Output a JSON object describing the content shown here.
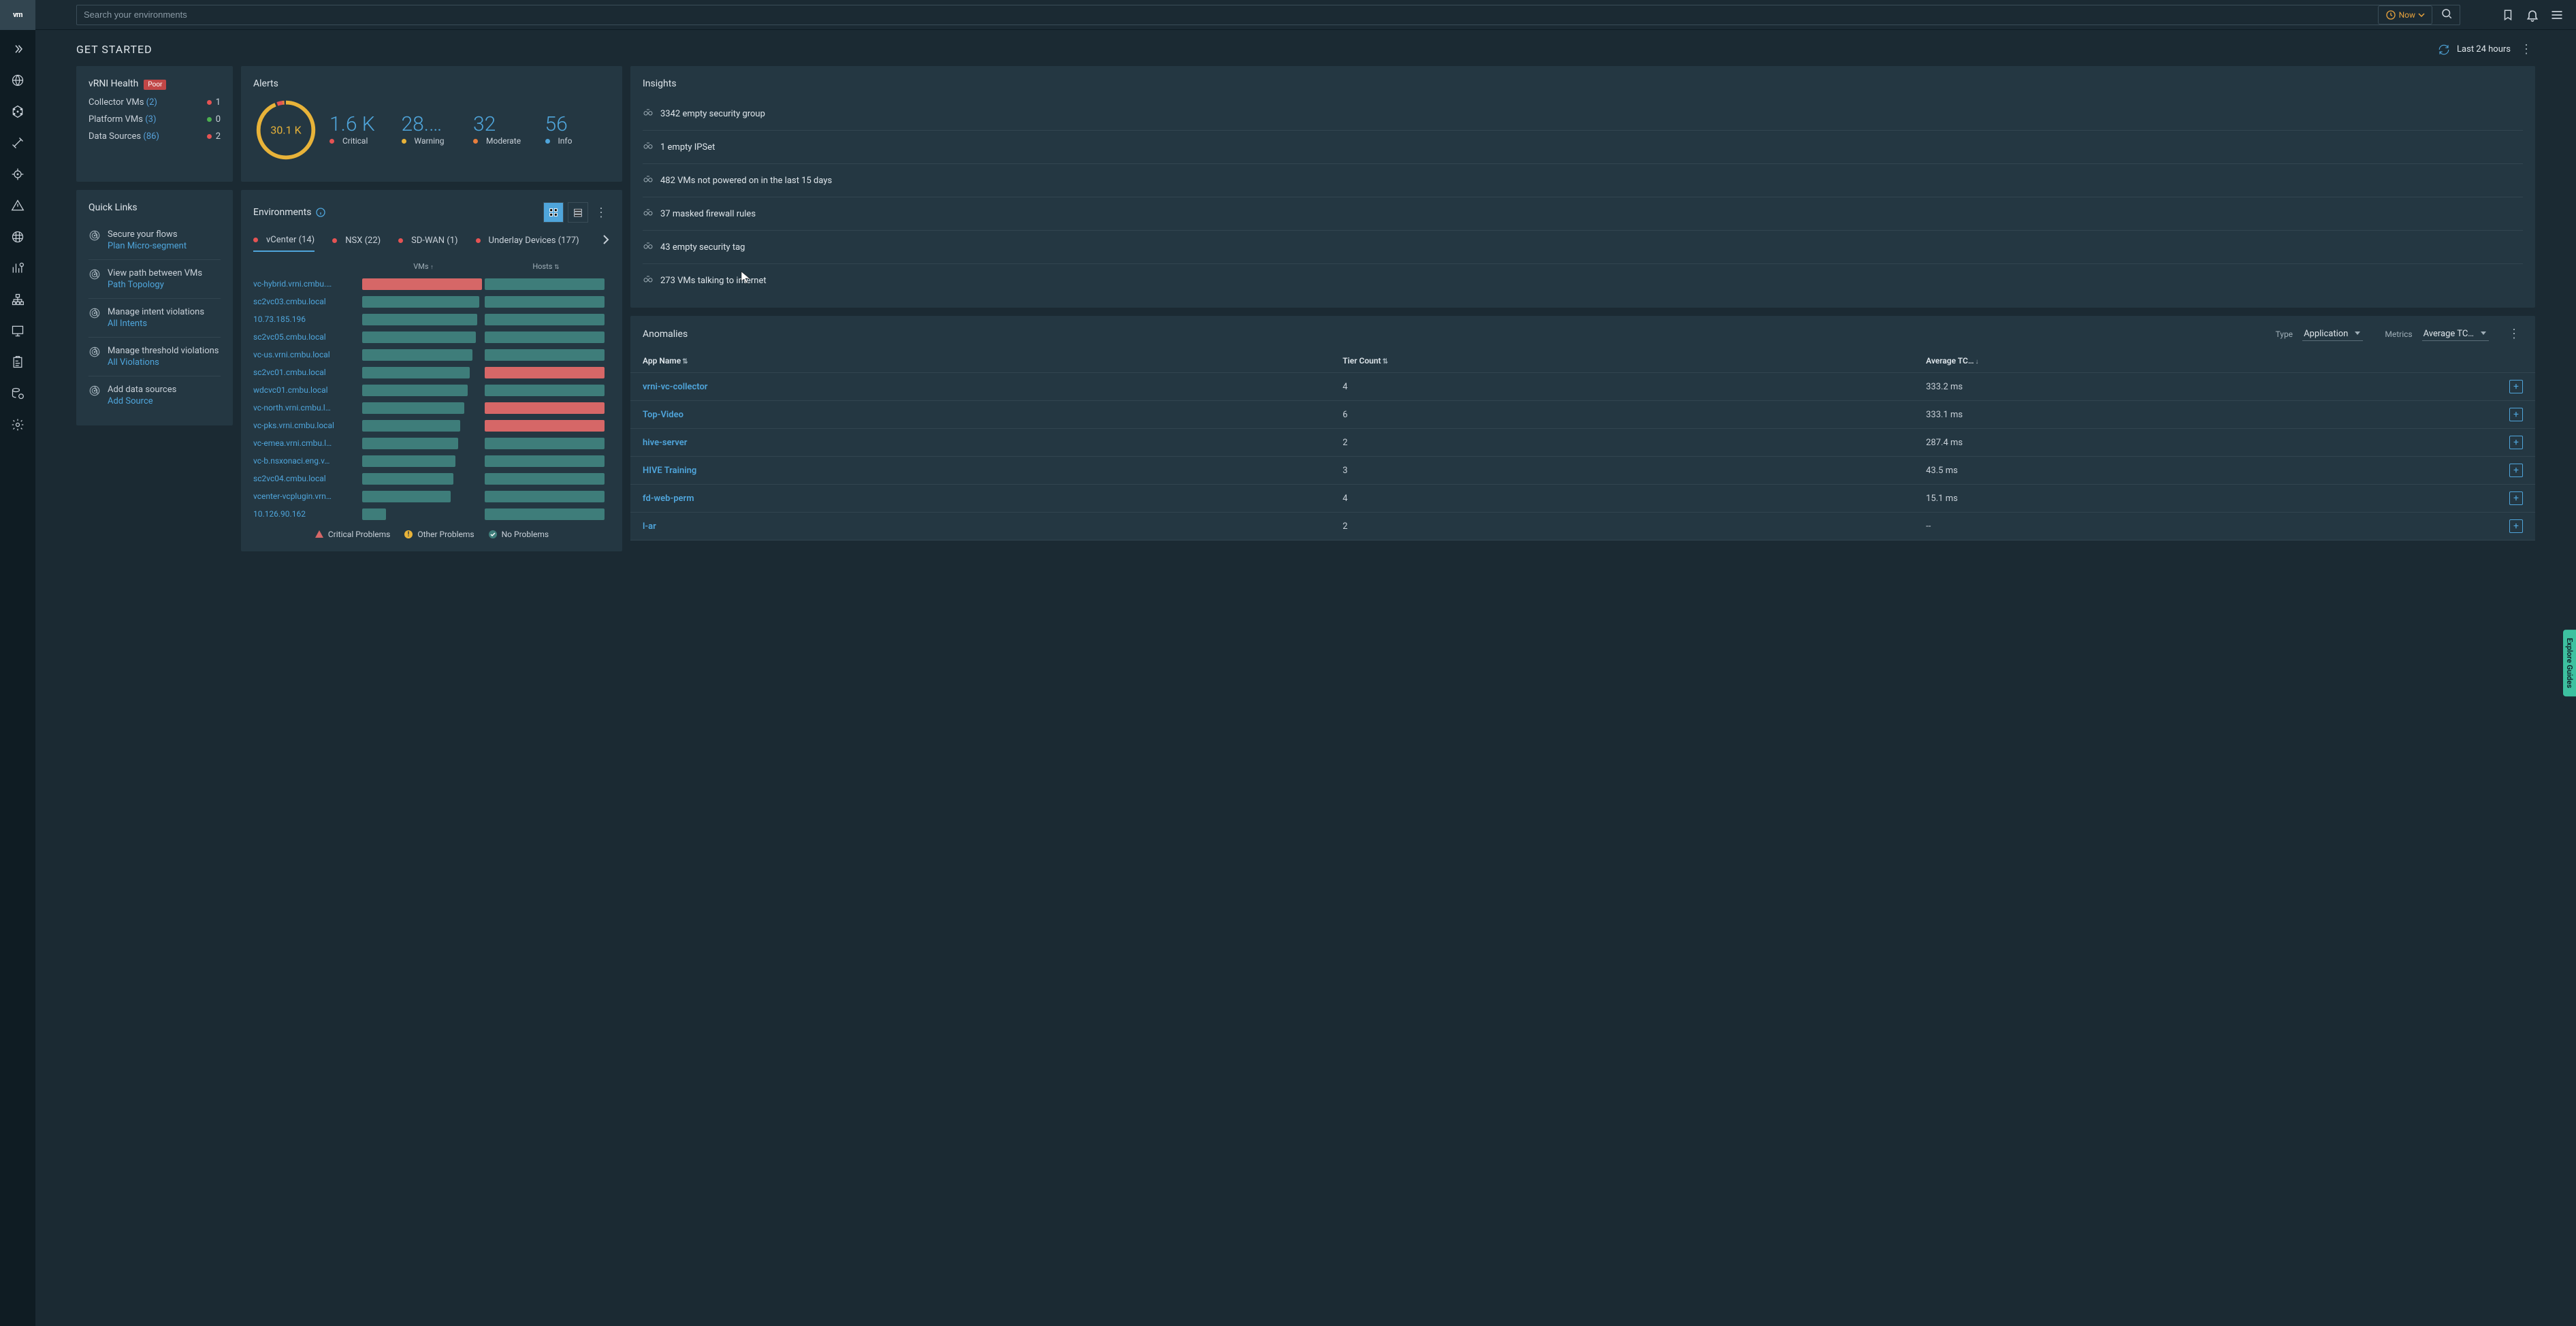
{
  "topbar": {
    "logo": "vm",
    "search_placeholder": "Search your environments",
    "now_label": "Now"
  },
  "header": {
    "title": "GET STARTED",
    "timerange": "Last 24 hours"
  },
  "health": {
    "title": "vRNI Health",
    "badge": "Poor",
    "rows": [
      {
        "label": "Collector VMs",
        "count": "(2)",
        "dot": "dot-red",
        "val": "1"
      },
      {
        "label": "Platform VMs",
        "count": "(3)",
        "dot": "dot-green",
        "val": "0"
      },
      {
        "label": "Data Sources",
        "count": "(86)",
        "dot": "dot-red",
        "val": "2"
      }
    ]
  },
  "alerts": {
    "title": "Alerts",
    "total": "30.1 K",
    "stats": [
      {
        "num": "1.6 K",
        "label": "Critical",
        "dot": "dot-red"
      },
      {
        "num": "28.…",
        "label": "Warning",
        "dot": "dot-yellow"
      },
      {
        "num": "32",
        "label": "Moderate",
        "dot": "dot-orange"
      },
      {
        "num": "56",
        "label": "Info",
        "dot": "dot-blue"
      }
    ]
  },
  "quicklinks": {
    "title": "Quick Links",
    "items": [
      {
        "text": "Secure your flows",
        "link": "Plan Micro-segment"
      },
      {
        "text": "View path between VMs",
        "link": "Path Topology"
      },
      {
        "text": "Manage intent violations",
        "link": "All Intents"
      },
      {
        "text": "Manage threshold violations",
        "link": "All Violations"
      },
      {
        "text": "Add data sources",
        "link": "Add Source"
      }
    ]
  },
  "environments": {
    "title": "Environments",
    "tabs": [
      {
        "label": "vCenter (14)",
        "active": true
      },
      {
        "label": "NSX (22)"
      },
      {
        "label": "SD-WAN (1)"
      },
      {
        "label": "Underlay Devices (177)"
      }
    ],
    "col_vms": "VMs",
    "col_hosts": "Hosts",
    "rows": [
      {
        "name": "vc-hybrid.vrni.cmbu.…",
        "vms": "red",
        "vw": 100,
        "hosts": "teal",
        "hw": 100
      },
      {
        "name": "sc2vc03.cmbu.local",
        "vms": "teal",
        "vw": 98,
        "hosts": "teal",
        "hw": 100
      },
      {
        "name": "10.73.185.196",
        "vms": "teal",
        "vw": 96,
        "hosts": "teal",
        "hw": 100
      },
      {
        "name": "sc2vc05.cmbu.local",
        "vms": "teal",
        "vw": 95,
        "hosts": "teal",
        "hw": 100
      },
      {
        "name": "vc-us.vrni.cmbu.local",
        "vms": "teal",
        "vw": 92,
        "hosts": "teal",
        "hw": 100
      },
      {
        "name": "sc2vc01.cmbu.local",
        "vms": "teal",
        "vw": 90,
        "hosts": "red",
        "hw": 100
      },
      {
        "name": "wdcvc01.cmbu.local",
        "vms": "teal",
        "vw": 88,
        "hosts": "teal",
        "hw": 100
      },
      {
        "name": "vc-north.vrni.cmbu.l…",
        "vms": "teal",
        "vw": 85,
        "hosts": "red",
        "hw": 100
      },
      {
        "name": "vc-pks.vrni.cmbu.local",
        "vms": "teal",
        "vw": 82,
        "hosts": "red",
        "hw": 100
      },
      {
        "name": "vc-emea.vrni.cmbu.l…",
        "vms": "teal",
        "vw": 80,
        "hosts": "teal",
        "hw": 100
      },
      {
        "name": "vc-b.nsxonaci.eng.v…",
        "vms": "teal",
        "vw": 78,
        "hosts": "teal",
        "hw": 100
      },
      {
        "name": "sc2vc04.cmbu.local",
        "vms": "teal",
        "vw": 76,
        "hosts": "teal",
        "hw": 100
      },
      {
        "name": "vcenter-vcplugin.vrn…",
        "vms": "teal",
        "vw": 74,
        "hosts": "teal",
        "hw": 100
      },
      {
        "name": "10.126.90.162",
        "vms": "teal",
        "vw": 20,
        "hosts": "teal",
        "hw": 100
      }
    ],
    "legend": {
      "critical": "Critical Problems",
      "other": "Other Problems",
      "none": "No Problems"
    }
  },
  "insights": {
    "title": "Insights",
    "items": [
      "3342 empty security group",
      "1 empty IPSet",
      "482 VMs not powered on in the last 15 days",
      "37 masked firewall rules",
      "43 empty security tag",
      "273 VMs talking to internet"
    ]
  },
  "anomalies": {
    "title": "Anomalies",
    "type_label": "Type",
    "type_value": "Application",
    "metrics_label": "Metrics",
    "metrics_value": "Average TC…",
    "cols": {
      "app": "App Name",
      "tier": "Tier Count",
      "avg": "Average TC…"
    },
    "rows": [
      {
        "app": "vrni-vc-collector",
        "tier": "4",
        "avg": "333.2 ms"
      },
      {
        "app": "Top-Video",
        "tier": "6",
        "avg": "333.1 ms"
      },
      {
        "app": "hive-server",
        "tier": "2",
        "avg": "287.4 ms"
      },
      {
        "app": "HIVE Training",
        "tier": "3",
        "avg": "43.5 ms"
      },
      {
        "app": "fd-web-perm",
        "tier": "4",
        "avg": "15.1 ms"
      },
      {
        "app": "l-ar",
        "tier": "2",
        "avg": "--"
      }
    ]
  },
  "explore": "Explore Guides"
}
